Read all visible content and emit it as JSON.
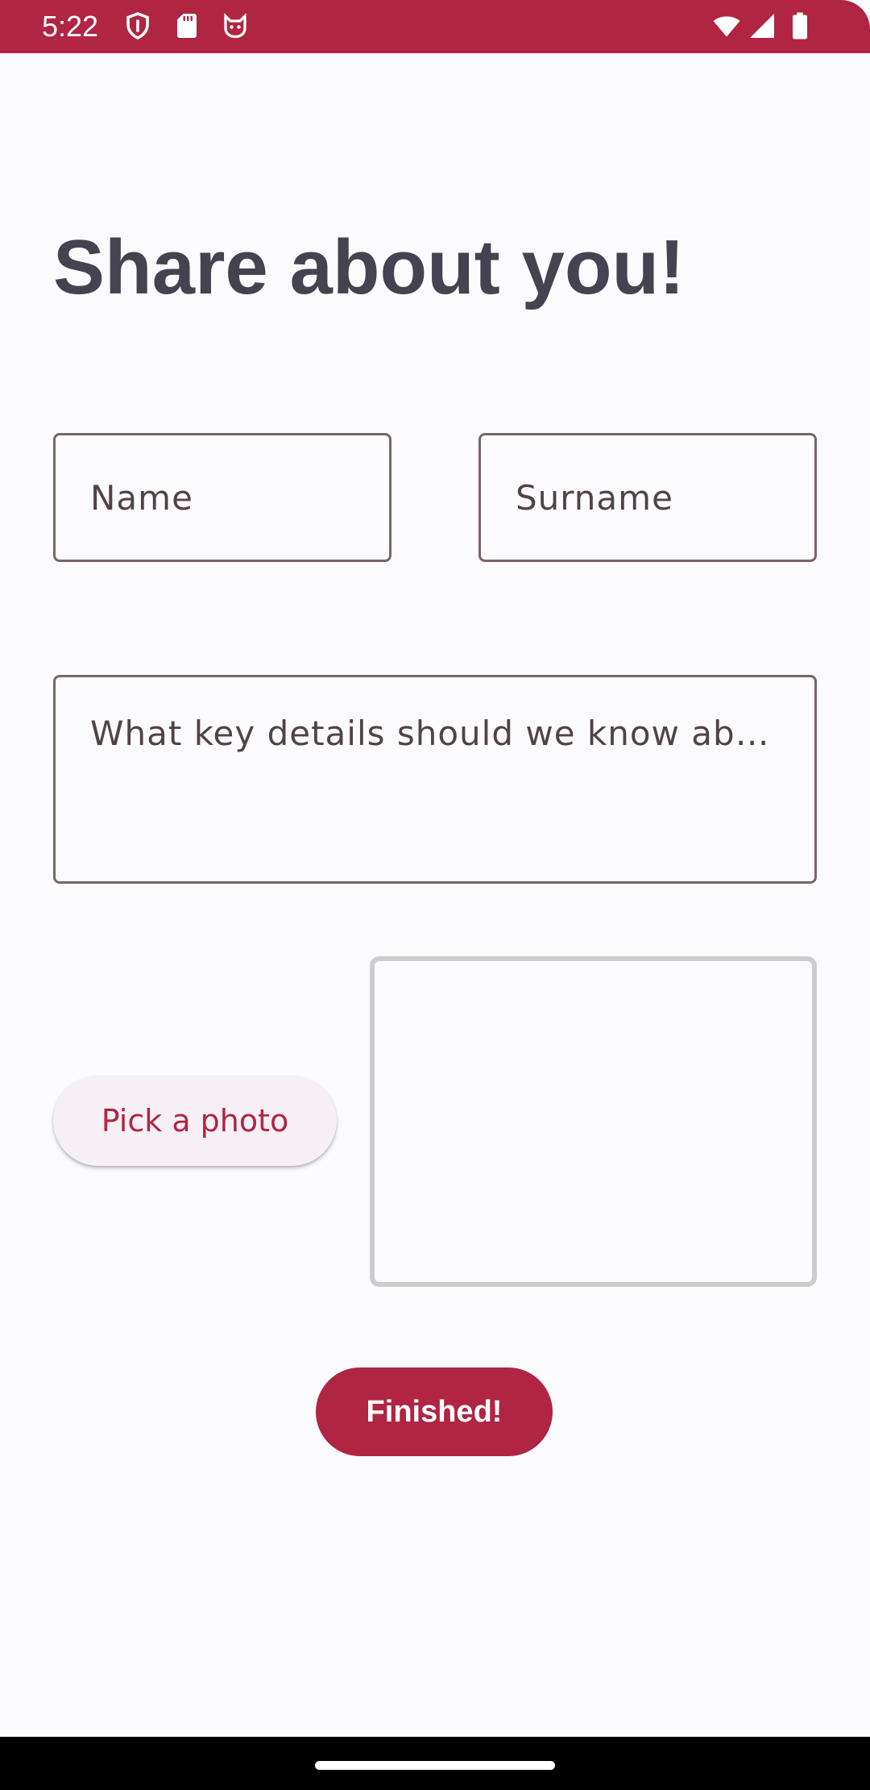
{
  "status_bar": {
    "time": "5:22",
    "left_icons": [
      "shield-icon",
      "sd-card-icon",
      "cat-face-icon"
    ],
    "right_icons": [
      "wifi-icon",
      "cell-signal-icon",
      "battery-icon"
    ],
    "color": "#b02542"
  },
  "page": {
    "title": "Share about you!"
  },
  "form": {
    "name_placeholder": "Name",
    "surname_placeholder": "Surname",
    "details_placeholder": "What key details should we know about…"
  },
  "photo": {
    "pick_label": "Pick a photo"
  },
  "actions": {
    "finished_label": "Finished!"
  },
  "colors": {
    "accent": "#b02542",
    "background": "#fbfbfe",
    "title": "#44434f",
    "field_border": "#7a6567"
  }
}
